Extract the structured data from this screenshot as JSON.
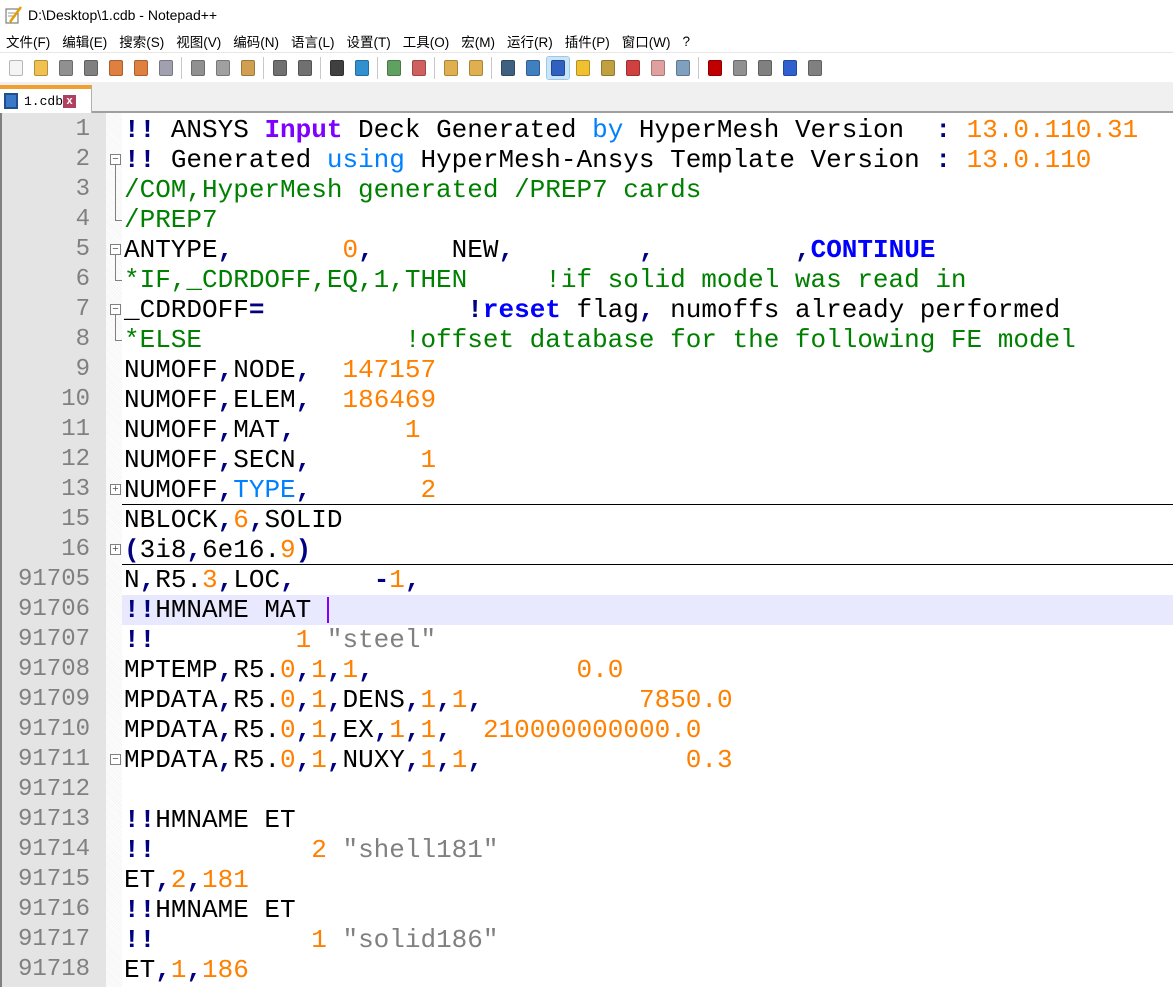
{
  "window": {
    "title": "D:\\Desktop\\1.cdb - Notepad++"
  },
  "menu": [
    "文件(F)",
    "编辑(E)",
    "搜索(S)",
    "视图(V)",
    "编码(N)",
    "语言(L)",
    "设置(T)",
    "工具(O)",
    "宏(M)",
    "运行(R)",
    "插件(P)",
    "窗口(W)",
    "?"
  ],
  "toolbar": [
    {
      "icon": "new-file-icon",
      "color": "#f4f4f4"
    },
    {
      "icon": "open-file-icon",
      "color": "#f0c050"
    },
    {
      "icon": "save-icon",
      "color": "#909090"
    },
    {
      "icon": "save-all-icon",
      "color": "#808080"
    },
    {
      "icon": "close-icon",
      "color": "#e08040"
    },
    {
      "icon": "close-all-icon",
      "color": "#e08040"
    },
    {
      "icon": "print-icon",
      "color": "#a0a0b0"
    },
    {
      "sep": true
    },
    {
      "icon": "cut-icon",
      "color": "#909090"
    },
    {
      "icon": "copy-icon",
      "color": "#a0a0a0"
    },
    {
      "icon": "paste-icon",
      "color": "#d0a050"
    },
    {
      "sep": true
    },
    {
      "icon": "undo-icon",
      "color": "#707070"
    },
    {
      "icon": "redo-icon",
      "color": "#707070"
    },
    {
      "sep": true
    },
    {
      "icon": "find-icon",
      "color": "#404040"
    },
    {
      "icon": "replace-icon",
      "color": "#3090d0"
    },
    {
      "sep": true
    },
    {
      "icon": "zoom-in-icon",
      "color": "#60a060"
    },
    {
      "icon": "zoom-out-icon",
      "color": "#d06060"
    },
    {
      "sep": true
    },
    {
      "icon": "sync-vertical-icon",
      "color": "#e0b050"
    },
    {
      "icon": "sync-horizontal-icon",
      "color": "#e0b050"
    },
    {
      "sep": true
    },
    {
      "icon": "word-wrap-icon",
      "color": "#406080"
    },
    {
      "icon": "show-all-chars-icon",
      "color": "#4080c0"
    },
    {
      "icon": "indent-guide-icon",
      "color": "#3060c0",
      "active": true
    },
    {
      "icon": "udl-icon",
      "color": "#f0c030"
    },
    {
      "icon": "doc-map-icon",
      "color": "#c0a040"
    },
    {
      "icon": "function-list-icon",
      "color": "#d04040"
    },
    {
      "icon": "folder-workspace-icon",
      "color": "#e0a0a0"
    },
    {
      "icon": "monitoring-icon",
      "color": "#80a0c0"
    },
    {
      "sep": true
    },
    {
      "icon": "record-macro-icon",
      "color": "#c00000"
    },
    {
      "icon": "stop-macro-icon",
      "color": "#909090"
    },
    {
      "icon": "play-macro-icon",
      "color": "#808080"
    },
    {
      "icon": "run-macro-multiple-icon",
      "color": "#3060d0"
    },
    {
      "icon": "save-macro-icon",
      "color": "#808080"
    }
  ],
  "tab": {
    "label": "1.cdb",
    "close": "x"
  },
  "editor": {
    "current_line": "91706",
    "lines": [
      {
        "n": "1",
        "t": [
          [
            "!!",
            "op"
          ],
          [
            " ANSYS ",
            "pl"
          ],
          [
            "Input",
            "kw"
          ],
          [
            " Deck Generated ",
            "pl"
          ],
          [
            "by",
            "lb"
          ],
          [
            " HyperMesh Version  ",
            "pl"
          ],
          [
            ":",
            "op"
          ],
          [
            " ",
            "pl"
          ],
          [
            "13.0.110.31",
            "num"
          ]
        ]
      },
      {
        "n": "2",
        "fold": "open",
        "t": [
          [
            "!!",
            "op"
          ],
          [
            " Generated ",
            "pl"
          ],
          [
            "using",
            "lb"
          ],
          [
            " HyperMesh-Ansys Template Version ",
            "pl"
          ],
          [
            ":",
            "op"
          ],
          [
            " ",
            "pl"
          ],
          [
            "13.0.110",
            "num"
          ]
        ]
      },
      {
        "n": "3",
        "fold": "mid",
        "t": [
          [
            "/COM,HyperMesh generated /PREP7 cards",
            "com"
          ]
        ]
      },
      {
        "n": "4",
        "fold": "end",
        "t": [
          [
            "/PREP7",
            "com"
          ]
        ]
      },
      {
        "n": "5",
        "fold": "open",
        "t": [
          [
            "ANTYPE",
            "pl"
          ],
          [
            ",",
            "op"
          ],
          [
            "       ",
            "pl"
          ],
          [
            "0",
            "num"
          ],
          [
            ",",
            "op"
          ],
          [
            "     NEW",
            "pl"
          ],
          [
            ",",
            "op"
          ],
          [
            "        ",
            "pl"
          ],
          [
            ",",
            "op"
          ],
          [
            "         ",
            "pl"
          ],
          [
            ",",
            "op"
          ],
          [
            "CONTINUE",
            "bb"
          ]
        ]
      },
      {
        "n": "6",
        "fold": "end",
        "t": [
          [
            "*IF,_CDRDOFF,EQ,1,THEN     !if solid model was read in",
            "com"
          ]
        ]
      },
      {
        "n": "7",
        "fold": "open",
        "t": [
          [
            "_CDRDOFF",
            "pl"
          ],
          [
            "=",
            "op"
          ],
          [
            "             ",
            "pl"
          ],
          [
            "!",
            "op"
          ],
          [
            "reset",
            "bb"
          ],
          [
            " flag",
            "pl"
          ],
          [
            ",",
            "op"
          ],
          [
            " numoffs already performed",
            "pl"
          ]
        ]
      },
      {
        "n": "8",
        "fold": "end",
        "t": [
          [
            "*ELSE             !offset database for the following FE model",
            "com"
          ]
        ]
      },
      {
        "n": "9",
        "t": [
          [
            "NUMOFF",
            "pl"
          ],
          [
            ",",
            "op"
          ],
          [
            "NODE",
            "pl"
          ],
          [
            ",",
            "op"
          ],
          [
            "  ",
            "pl"
          ],
          [
            "147157",
            "num"
          ]
        ]
      },
      {
        "n": "10",
        "t": [
          [
            "NUMOFF",
            "pl"
          ],
          [
            ",",
            "op"
          ],
          [
            "ELEM",
            "pl"
          ],
          [
            ",",
            "op"
          ],
          [
            "  ",
            "pl"
          ],
          [
            "186469",
            "num"
          ]
        ]
      },
      {
        "n": "11",
        "t": [
          [
            "NUMOFF",
            "pl"
          ],
          [
            ",",
            "op"
          ],
          [
            "MAT",
            "pl"
          ],
          [
            ",",
            "op"
          ],
          [
            "       ",
            "pl"
          ],
          [
            "1",
            "num"
          ]
        ]
      },
      {
        "n": "12",
        "t": [
          [
            "NUMOFF",
            "pl"
          ],
          [
            ",",
            "op"
          ],
          [
            "SECN",
            "pl"
          ],
          [
            ",",
            "op"
          ],
          [
            "       ",
            "pl"
          ],
          [
            "1",
            "num"
          ]
        ]
      },
      {
        "n": "13",
        "fold": "closed",
        "t": [
          [
            "NUMOFF",
            "pl"
          ],
          [
            ",",
            "op"
          ],
          [
            "TYPE",
            "lb"
          ],
          [
            ",",
            "op"
          ],
          [
            "       ",
            "pl"
          ],
          [
            "2",
            "num"
          ]
        ]
      },
      {
        "n": "15",
        "t": [
          [
            "NBLOCK",
            "pl"
          ],
          [
            ",",
            "op"
          ],
          [
            "6",
            "num"
          ],
          [
            ",",
            "op"
          ],
          [
            "SOLID",
            "pl"
          ]
        ]
      },
      {
        "n": "16",
        "fold": "closed",
        "t": [
          [
            "(",
            "op"
          ],
          [
            "3i8",
            "pl"
          ],
          [
            ",",
            "op"
          ],
          [
            "6e16.",
            "pl"
          ],
          [
            "9",
            "num"
          ],
          [
            ")",
            "op"
          ]
        ]
      },
      {
        "n": "91705",
        "t": [
          [
            "N",
            "pl"
          ],
          [
            ",",
            "op"
          ],
          [
            "R5.",
            "pl"
          ],
          [
            "3",
            "num"
          ],
          [
            ",",
            "op"
          ],
          [
            "LOC",
            "pl"
          ],
          [
            ",",
            "op"
          ],
          [
            "     ",
            "pl"
          ],
          [
            "-",
            "op"
          ],
          [
            "1",
            "num"
          ],
          [
            ",",
            "op"
          ]
        ]
      },
      {
        "n": "91706",
        "t": [
          [
            "!!",
            "op"
          ],
          [
            "HMNAME MAT ",
            "pl"
          ]
        ]
      },
      {
        "n": "91707",
        "t": [
          [
            "!!",
            "op"
          ],
          [
            "         ",
            "pl"
          ],
          [
            "1",
            "num"
          ],
          [
            " ",
            "pl"
          ],
          [
            "\"steel\"",
            "str"
          ]
        ]
      },
      {
        "n": "91708",
        "t": [
          [
            "MPTEMP",
            "pl"
          ],
          [
            ",",
            "op"
          ],
          [
            "R5.",
            "pl"
          ],
          [
            "0",
            "num"
          ],
          [
            ",",
            "op"
          ],
          [
            "1",
            "num"
          ],
          [
            ",",
            "op"
          ],
          [
            "1",
            "num"
          ],
          [
            ",",
            "op"
          ],
          [
            "             ",
            "pl"
          ],
          [
            "0.0",
            "num"
          ]
        ]
      },
      {
        "n": "91709",
        "t": [
          [
            "MPDATA",
            "pl"
          ],
          [
            ",",
            "op"
          ],
          [
            "R5.",
            "pl"
          ],
          [
            "0",
            "num"
          ],
          [
            ",",
            "op"
          ],
          [
            "1",
            "num"
          ],
          [
            ",",
            "op"
          ],
          [
            "DENS",
            "pl"
          ],
          [
            ",",
            "op"
          ],
          [
            "1",
            "num"
          ],
          [
            ",",
            "op"
          ],
          [
            "1",
            "num"
          ],
          [
            ",",
            "op"
          ],
          [
            "          ",
            "pl"
          ],
          [
            "7850.0",
            "num"
          ]
        ]
      },
      {
        "n": "91710",
        "t": [
          [
            "MPDATA",
            "pl"
          ],
          [
            ",",
            "op"
          ],
          [
            "R5.",
            "pl"
          ],
          [
            "0",
            "num"
          ],
          [
            ",",
            "op"
          ],
          [
            "1",
            "num"
          ],
          [
            ",",
            "op"
          ],
          [
            "EX",
            "pl"
          ],
          [
            ",",
            "op"
          ],
          [
            "1",
            "num"
          ],
          [
            ",",
            "op"
          ],
          [
            "1",
            "num"
          ],
          [
            ",",
            "op"
          ],
          [
            "  ",
            "pl"
          ],
          [
            "210000000000.0",
            "num"
          ]
        ]
      },
      {
        "n": "91711",
        "fold": "open-solo",
        "t": [
          [
            "MPDATA",
            "pl"
          ],
          [
            ",",
            "op"
          ],
          [
            "R5.",
            "pl"
          ],
          [
            "0",
            "num"
          ],
          [
            ",",
            "op"
          ],
          [
            "1",
            "num"
          ],
          [
            ",",
            "op"
          ],
          [
            "NUXY",
            "pl"
          ],
          [
            ",",
            "op"
          ],
          [
            "1",
            "num"
          ],
          [
            ",",
            "op"
          ],
          [
            "1",
            "num"
          ],
          [
            ",",
            "op"
          ],
          [
            "             ",
            "pl"
          ],
          [
            "0.3",
            "num"
          ]
        ]
      },
      {
        "n": "91712",
        "t": []
      },
      {
        "n": "91713",
        "t": [
          [
            "!!",
            "op"
          ],
          [
            "HMNAME ET",
            "pl"
          ]
        ]
      },
      {
        "n": "91714",
        "t": [
          [
            "!!",
            "op"
          ],
          [
            "          ",
            "pl"
          ],
          [
            "2",
            "num"
          ],
          [
            " ",
            "pl"
          ],
          [
            "\"shell181\"",
            "str"
          ]
        ]
      },
      {
        "n": "91715",
        "t": [
          [
            "ET",
            "pl"
          ],
          [
            ",",
            "op"
          ],
          [
            "2",
            "num"
          ],
          [
            ",",
            "op"
          ],
          [
            "181",
            "num"
          ]
        ]
      },
      {
        "n": "91716",
        "t": [
          [
            "!!",
            "op"
          ],
          [
            "HMNAME ET",
            "pl"
          ]
        ]
      },
      {
        "n": "91717",
        "t": [
          [
            "!!",
            "op"
          ],
          [
            "          ",
            "pl"
          ],
          [
            "1",
            "num"
          ],
          [
            " ",
            "pl"
          ],
          [
            "\"solid186\"",
            "str"
          ]
        ]
      },
      {
        "n": "91718",
        "t": [
          [
            "ET",
            "pl"
          ],
          [
            ",",
            "op"
          ],
          [
            "1",
            "num"
          ],
          [
            ",",
            "op"
          ],
          [
            "186",
            "num"
          ]
        ]
      }
    ]
  }
}
